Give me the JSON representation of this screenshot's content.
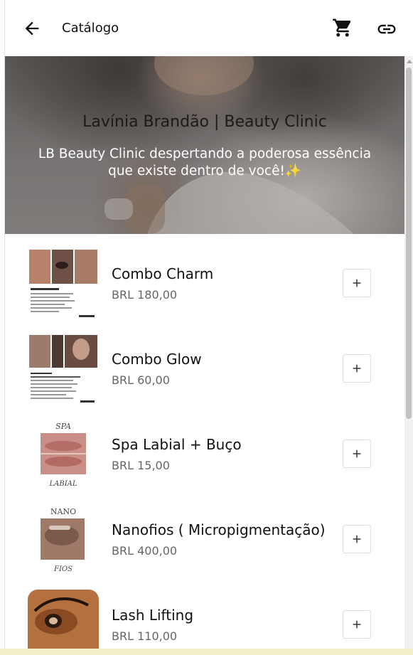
{
  "header": {
    "title": "Catálogo",
    "back_icon": "arrow-back-icon",
    "cart_icon": "cart-icon",
    "link_icon": "link-icon"
  },
  "banner": {
    "title": "Lavínia Brandão | Beauty Clinic",
    "subtitle": "LB Beauty Clinic despertando a poderosa essência que existe dentro de você!✨"
  },
  "products": [
    {
      "name": "Combo Charm",
      "price": "BRL 180,00",
      "thumb": {
        "heading": "COMBO CHARM"
      }
    },
    {
      "name": "Combo Glow",
      "price": "BRL 60,00",
      "thumb": {
        "heading": "COMBO GLOW"
      }
    },
    {
      "name": "Spa Labial + Buço",
      "price": "BRL 15,00",
      "thumb": {
        "top": "SPA",
        "bottom": "LABIAL"
      }
    },
    {
      "name": "Nanofios ( Micropigmentação)",
      "price": "BRL 400,00",
      "thumb": {
        "top": "NANO",
        "bottom": "FIOS"
      }
    },
    {
      "name": "Lash Lifting",
      "price": "BRL 110,00",
      "thumb": {}
    }
  ],
  "colors": {
    "accent_text": "#111111",
    "price_text": "#666666",
    "background": "#ffffff"
  }
}
